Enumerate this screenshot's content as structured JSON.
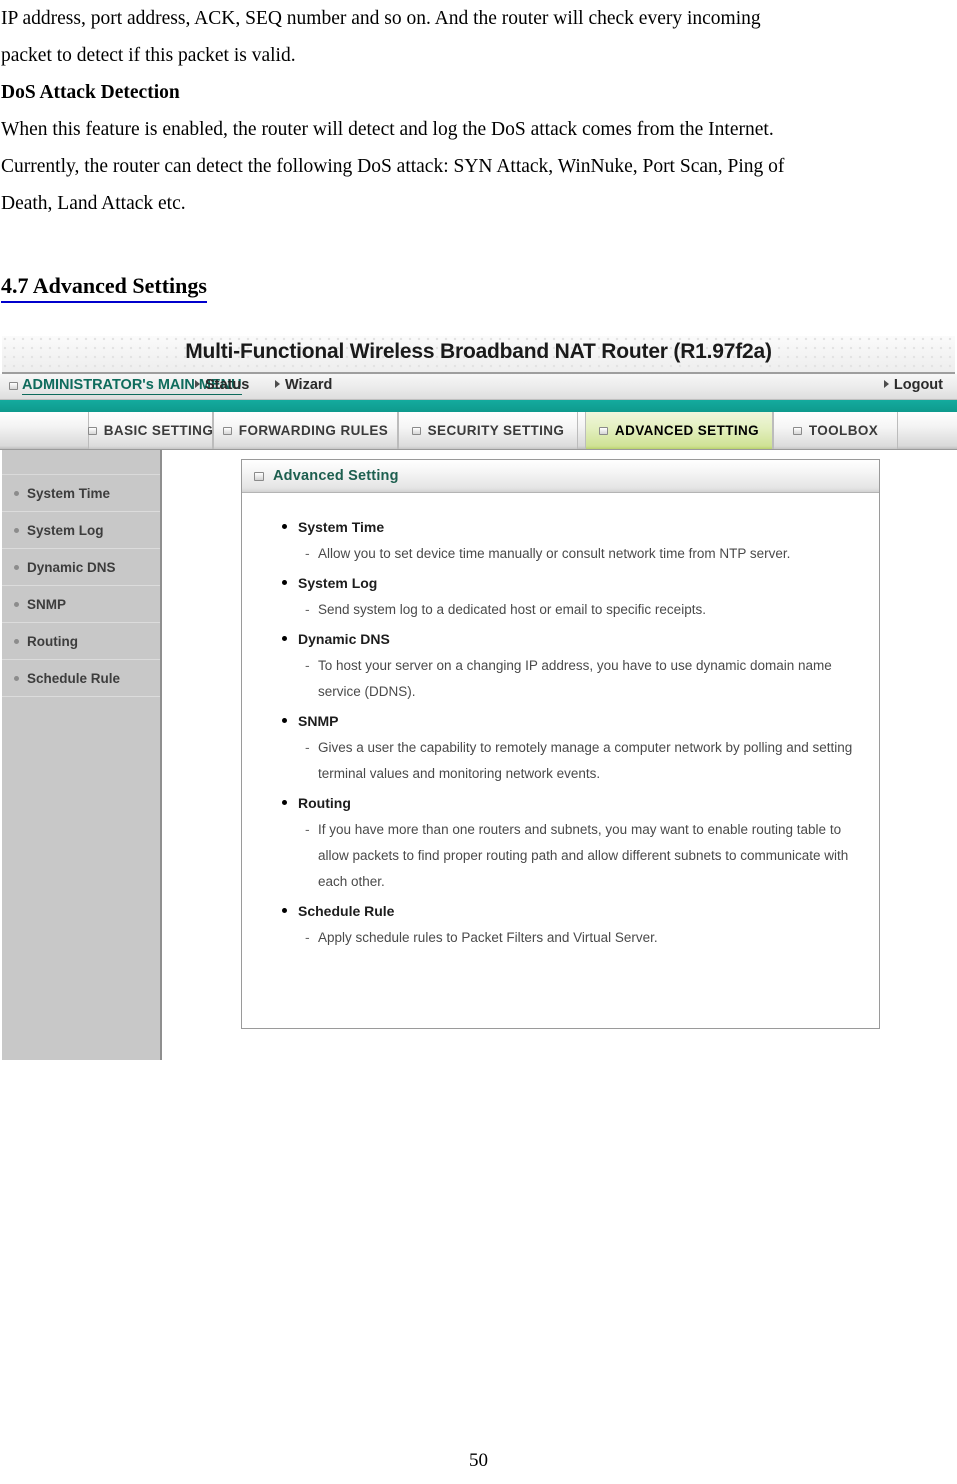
{
  "document": {
    "paragraph_lines": [
      "IP address, port address, ACK, SEQ number and so on. And the router will check every incoming",
      "packet to detect if this packet is valid."
    ],
    "subheading": "DoS Attack Detection",
    "paragraph2_lines": [
      "When this feature is enabled, the router will detect and log the DoS attack comes from the Internet.",
      "Currently, the router can detect the following DoS attack: SYN Attack, WinNuke, Port Scan, Ping of",
      "Death, Land Attack etc."
    ],
    "section_heading": "4.7 Advanced Settings",
    "page_number": "50"
  },
  "router_ui": {
    "title": "Multi-Functional Wireless Broadband NAT Router (R1.97f2a)",
    "menubar": {
      "main_menu": "ADMINISTRATOR's MAIN MENU",
      "status": "Status",
      "wizard": "Wizard",
      "logout": "Logout"
    },
    "tabs": [
      {
        "label": "BASIC SETTING",
        "active": false
      },
      {
        "label": "FORWARDING RULES",
        "active": false
      },
      {
        "label": "SECURITY SETTING",
        "active": false
      },
      {
        "label": "ADVANCED SETTING",
        "active": true
      },
      {
        "label": "TOOLBOX",
        "active": false
      }
    ],
    "sidebar": {
      "items": [
        {
          "label": "System Time"
        },
        {
          "label": "System Log"
        },
        {
          "label": "Dynamic DNS"
        },
        {
          "label": "SNMP"
        },
        {
          "label": "Routing"
        },
        {
          "label": "Schedule Rule"
        }
      ]
    },
    "panel": {
      "title": "Advanced Setting",
      "features": [
        {
          "name": "System Time",
          "description": "Allow you to set device time manually or consult network time from NTP server."
        },
        {
          "name": "System Log",
          "description": "Send system log to a dedicated host or email to specific receipts."
        },
        {
          "name": "Dynamic DNS",
          "description": "To host your server on a changing IP address, you have to use dynamic domain name service (DDNS)."
        },
        {
          "name": "SNMP",
          "description": "Gives a user the capability to remotely manage a computer network by polling and setting terminal values and monitoring network events."
        },
        {
          "name": "Routing",
          "description": "If you have more than one routers and subnets, you may want to enable routing table to allow packets to find proper routing path and allow different subnets to communicate with each other."
        },
        {
          "name": "Schedule Rule",
          "description": "Apply schedule rules to Packet Filters and Virtual Server."
        }
      ]
    },
    "colors": {
      "teal_band": "#0e9a8d",
      "menu_link": "#0e6b5c",
      "panel_title": "#1d5f4f",
      "active_tab": "#cfe295",
      "sidebar_bg": "#c8c8c8"
    }
  }
}
